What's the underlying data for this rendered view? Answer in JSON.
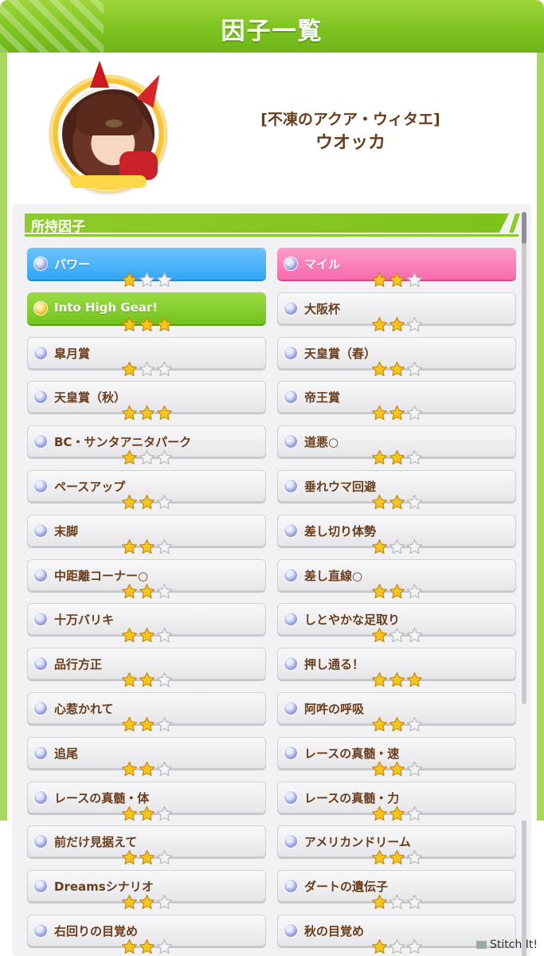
{
  "header": {
    "title": "因子一覧"
  },
  "character": {
    "outfit": "[不凍のアクア・ウィタエ]",
    "name": "ウオッカ"
  },
  "section": {
    "title": "所持因子"
  },
  "factors_left": [
    {
      "name": "パワー",
      "stars": 1,
      "style": "blue"
    },
    {
      "name": "Into High Gear!",
      "stars": 3,
      "style": "green"
    },
    {
      "name": "皐月賞",
      "stars": 1,
      "style": "normal"
    },
    {
      "name": "天皇賞（秋）",
      "stars": 3,
      "style": "normal"
    },
    {
      "name": "BC・サンタアニタパーク",
      "stars": 1,
      "style": "normal"
    },
    {
      "name": "ペースアップ",
      "stars": 2,
      "style": "normal"
    },
    {
      "name": "末脚",
      "stars": 2,
      "style": "normal"
    },
    {
      "name": "中距離コーナー○",
      "stars": 2,
      "style": "normal"
    },
    {
      "name": "十万バリキ",
      "stars": 2,
      "style": "normal"
    },
    {
      "name": "品行方正",
      "stars": 2,
      "style": "normal"
    },
    {
      "name": "心惹かれて",
      "stars": 2,
      "style": "normal"
    },
    {
      "name": "追尾",
      "stars": 2,
      "style": "normal"
    },
    {
      "name": "レースの真髄・体",
      "stars": 2,
      "style": "normal"
    },
    {
      "name": "前だけ見据えて",
      "stars": 2,
      "style": "normal"
    },
    {
      "name": "Dreamsシナリオ",
      "stars": 2,
      "style": "normal"
    },
    {
      "name": "右回りの目覚め",
      "stars": 2,
      "style": "normal"
    }
  ],
  "factors_right": [
    {
      "name": "マイル",
      "stars": 2,
      "style": "pink"
    },
    {
      "name": "大阪杯",
      "stars": 2,
      "style": "normal"
    },
    {
      "name": "天皇賞（春）",
      "stars": 2,
      "style": "normal"
    },
    {
      "name": "帝王賞",
      "stars": 2,
      "style": "normal"
    },
    {
      "name": "道悪○",
      "stars": 2,
      "style": "normal"
    },
    {
      "name": "垂れウマ回避",
      "stars": 2,
      "style": "normal"
    },
    {
      "name": "差し切り体勢",
      "stars": 1,
      "style": "normal"
    },
    {
      "name": "差し直線○",
      "stars": 2,
      "style": "normal"
    },
    {
      "name": "しとやかな足取り",
      "stars": 1,
      "style": "normal"
    },
    {
      "name": "押し通る！",
      "stars": 3,
      "style": "normal"
    },
    {
      "name": "阿吽の呼吸",
      "stars": 2,
      "style": "normal"
    },
    {
      "name": "レースの真髄・速",
      "stars": 2,
      "style": "normal"
    },
    {
      "name": "レースの真髄・力",
      "stars": 2,
      "style": "normal"
    },
    {
      "name": "アメリカンドリーム",
      "stars": 2,
      "style": "normal"
    },
    {
      "name": "ダートの遺伝子",
      "stars": 1,
      "style": "normal"
    },
    {
      "name": "秋の目覚め",
      "stars": 1,
      "style": "normal"
    }
  ],
  "watermark": "Stitch It!"
}
